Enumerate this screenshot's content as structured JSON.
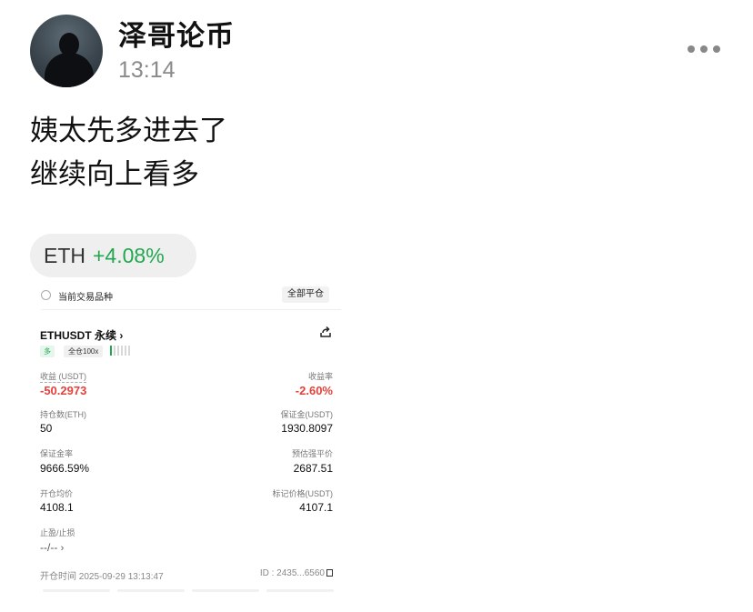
{
  "post": {
    "author": "泽哥论币",
    "time": "13:14",
    "text_line1": "姨太先多进去了",
    "text_line2": "继续向上看多"
  },
  "ticker": {
    "symbol": "ETH",
    "change": "+4.08%"
  },
  "position_card": {
    "current_symbol_label": "当前交易品种",
    "close_all_label": "全部平仓",
    "contract": "ETHUSDT 永续",
    "direction_tag": "多",
    "leverage_tag": "全仓100x",
    "pnl_label": "收益 (USDT)",
    "pnl_value": "-50.2973",
    "roe_label": "收益率",
    "roe_value": "-2.60%",
    "size_label": "持仓数(ETH)",
    "size_value": "50",
    "margin_label": "保证金(USDT)",
    "margin_value": "1930.8097",
    "margin_ratio_label": "保证金率",
    "margin_ratio_value": "9666.59%",
    "liq_label": "预估强平价",
    "liq_value": "2687.51",
    "entry_label": "开仓均价",
    "entry_value": "4108.1",
    "mark_label": "标记价格(USDT)",
    "mark_value": "4107.1",
    "tpsl_label": "止盈/止损",
    "tpsl_value": "--/--",
    "open_time": "开仓时间 2025-09-29 13:13:47",
    "id": "ID : 2435...6560"
  },
  "colors": {
    "positive": "#21a84f",
    "negative": "#e5413a"
  }
}
